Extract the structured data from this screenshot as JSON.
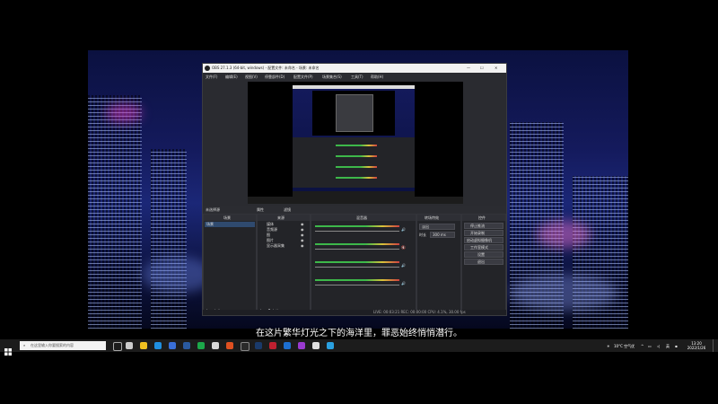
{
  "obs": {
    "title": "OBS 27.1.3 (64-bit, windows) - 配置文件: 未命名 - 场景: 未命名",
    "menu": [
      "文件(F)",
      "编辑(E)",
      "视图(V)",
      "停靠部件(D)",
      "配置文件(P)",
      "场景集合(S)",
      "工具(T)",
      "帮助(H)"
    ],
    "no_source_label": "未选择源",
    "props_button": "属性",
    "filters_button": "滤镜",
    "docks": {
      "scenes": "场景",
      "sources": "来源",
      "mixer": "混音器",
      "transitions": "转场特效",
      "controls": "控件"
    },
    "scene_items": [
      "场景"
    ],
    "source_items": [
      "媒体",
      "音频源",
      "图",
      "图片",
      "显示器采集"
    ],
    "transitions": {
      "type": "淡出",
      "duration_label": "时长",
      "duration": "300 ms"
    },
    "controls": [
      "停止推流",
      "开始录制",
      "启动虚拟摄像机",
      "工作室模式",
      "设置",
      "退出"
    ],
    "status": "LIVE: 00:03:21  REC: 00:00:00  CPU: 4.1%, 30.00 fps"
  },
  "subtitle": "在这片繁华灯光之下的海洋里，罪恶始终悄悄潜行。",
  "taskbar": {
    "search_placeholder": "在这里输入你要搜索的内容",
    "weather": "10°C 空气优",
    "ime": "英",
    "time": "13:20",
    "date": "2022/1/26"
  },
  "colors": {
    "obs_bg": "#1e1f24",
    "meter_green": "#3db84a",
    "meter_yellow": "#d8c23a",
    "meter_red": "#d04040"
  }
}
